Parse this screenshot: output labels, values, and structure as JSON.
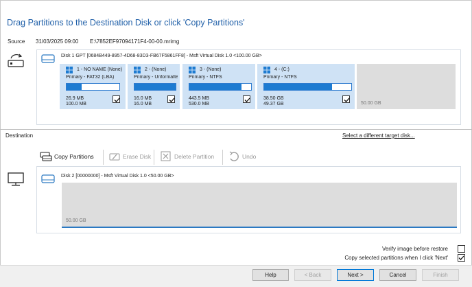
{
  "title": "Drag Partitions to the Destination Disk or click 'Copy Partitions'",
  "source": {
    "label": "Source",
    "date": "31/03/2025 09:00",
    "path": "E:\\7852EF97094171F4-00-00.mrimg"
  },
  "source_disk": {
    "header": "Disk 1 GPT [0684B449-8957-4D68-83D3-FB67F5861FF8] - Msft      Virtual Disk      1.0   <100.00 GB>",
    "partitions": [
      {
        "name": "1 - NO NAME (None)",
        "type": "Primary - FAT32 (LBA)",
        "used": "26.9 MB",
        "total": "100.0 MB",
        "fill": 0.28,
        "checked": true
      },
      {
        "name": "2 -  (None)",
        "type": "Primary - Unformatte",
        "used": "16.0 MB",
        "total": "16.0 MB",
        "fill": 1.0,
        "checked": true
      },
      {
        "name": "3 -  (None)",
        "type": "Primary - NTFS",
        "used": "443.5 MB",
        "total": "530.0 MB",
        "fill": 0.84,
        "checked": true
      },
      {
        "name": "4 -  (C:)",
        "type": "Primary - NTFS",
        "used": "38.50 GB",
        "total": "49.37 GB",
        "fill": 0.78,
        "checked": true
      }
    ],
    "unallocated": "50.00 GB"
  },
  "destination": {
    "label": "Destination",
    "select_link": "Select a different target disk...",
    "toolbar": {
      "copy": "Copy Partitions",
      "erase": "Erase Disk",
      "delete": "Delete Partition",
      "undo": "Undo"
    },
    "disk_header": "Disk 2 [00000000] - Msft      Virtual Disk      1.0   <50.00 GB>",
    "unallocated": "50.00 GB"
  },
  "options": {
    "verify": "Verify image before restore",
    "verify_checked": false,
    "copy_next": "Copy selected partitions when I click 'Next'",
    "copy_next_checked": true
  },
  "buttons": {
    "help": "Help",
    "back": "< Back",
    "next": "Next >",
    "cancel": "Cancel",
    "finish": "Finish"
  },
  "colors": {
    "title": "#1f5fa8",
    "partition_bg": "#cfe2f5",
    "bar_fill": "#1d7bd1",
    "unallocated": "#dddddd",
    "accent_line": "#2b79c2"
  }
}
